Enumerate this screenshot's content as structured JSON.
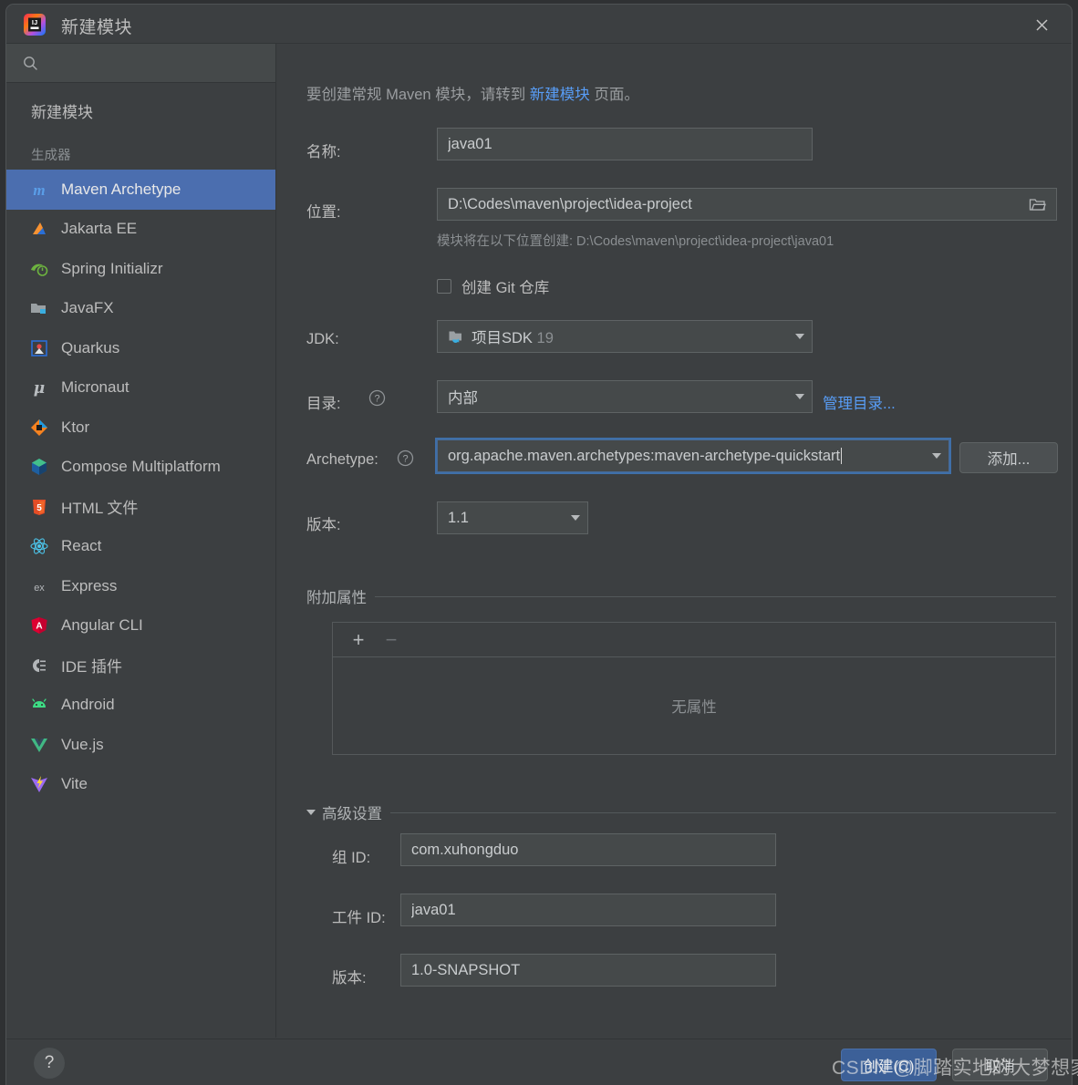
{
  "window": {
    "title": "新建模块",
    "logo_icon": "intellij-idea-logo",
    "close_icon": "close-icon"
  },
  "sidebar": {
    "search": {
      "value": "",
      "placeholder": "",
      "icon": "search-icon"
    },
    "root_item": {
      "label": "新建模块"
    },
    "group_header": "生成器",
    "items": [
      {
        "label": "Maven Archetype",
        "icon": "maven-icon",
        "selected": true
      },
      {
        "label": "Jakarta EE",
        "icon": "jakarta-ee-icon",
        "selected": false
      },
      {
        "label": "Spring Initializr",
        "icon": "spring-icon",
        "selected": false
      },
      {
        "label": "JavaFX",
        "icon": "javafx-icon",
        "selected": false
      },
      {
        "label": "Quarkus",
        "icon": "quarkus-icon",
        "selected": false
      },
      {
        "label": "Micronaut",
        "icon": "micronaut-icon",
        "selected": false
      },
      {
        "label": "Ktor",
        "icon": "ktor-icon",
        "selected": false
      },
      {
        "label": "Compose Multiplatform",
        "icon": "compose-icon",
        "selected": false
      },
      {
        "label": "HTML 文件",
        "icon": "html5-icon",
        "selected": false
      },
      {
        "label": "React",
        "icon": "react-icon",
        "selected": false
      },
      {
        "label": "Express",
        "icon": "express-icon",
        "selected": false
      },
      {
        "label": "Angular CLI",
        "icon": "angular-icon",
        "selected": false
      },
      {
        "label": "IDE 插件",
        "icon": "plugin-icon",
        "selected": false
      },
      {
        "label": "Android",
        "icon": "android-icon",
        "selected": false
      },
      {
        "label": "Vue.js",
        "icon": "vuejs-icon",
        "selected": false
      },
      {
        "label": "Vite",
        "icon": "vite-icon",
        "selected": false
      }
    ]
  },
  "main": {
    "description": {
      "before": "要创建常规 Maven 模块，请转到 ",
      "link": "新建模块",
      "after": " 页面。"
    },
    "name": {
      "label": "名称:",
      "value": "java01"
    },
    "location": {
      "label": "位置:",
      "value": "D:\\Codes\\maven\\project\\idea-project",
      "browse_icon": "folder-browse-icon",
      "hint": "模块将在以下位置创建: D:\\Codes\\maven\\project\\idea-project\\java01"
    },
    "git": {
      "label": "创建 Git 仓库",
      "checked": false
    },
    "jdk": {
      "label": "JDK:",
      "value_main": "项目SDK",
      "value_dim": "19",
      "icon": "jdk-folder-icon"
    },
    "catalog": {
      "label": "目录:",
      "help_icon": "help-circle-icon",
      "value": "内部",
      "manage_link": "管理目录..."
    },
    "archetype": {
      "label": "Archetype:",
      "help_icon": "help-circle-icon",
      "value": "org.apache.maven.archetypes:maven-archetype-quickstart",
      "add_button": "添加...",
      "focused": true
    },
    "archetype_version": {
      "label": "版本:",
      "value": "1.1"
    },
    "properties": {
      "section_title": "附加属性",
      "add_icon": "plus-icon",
      "remove_icon": "minus-icon",
      "empty_text": "无属性"
    },
    "advanced": {
      "section_title": "高级设置",
      "chevron_icon": "chevron-down-icon",
      "group_id": {
        "label": "组 ID:",
        "value": "com.xuhongduo"
      },
      "artifact_id": {
        "label": "工件 ID:",
        "value": "java01"
      },
      "version": {
        "label": "版本:",
        "value": "1.0-SNAPSHOT"
      }
    }
  },
  "footer": {
    "help_icon": "help-question-icon",
    "create_button": "创建(C)",
    "cancel_button": "取消"
  },
  "watermark": "CSDN @脚踏实地的大梦想家",
  "colors": {
    "dialog_bg": "#3c3f41",
    "field_bg": "#45494a",
    "selection_blue": "#4b6eaf",
    "link_blue": "#589df6",
    "primary_button": "#3c6098",
    "text": "#bdbdbd",
    "muted_text": "#8b8f92"
  }
}
